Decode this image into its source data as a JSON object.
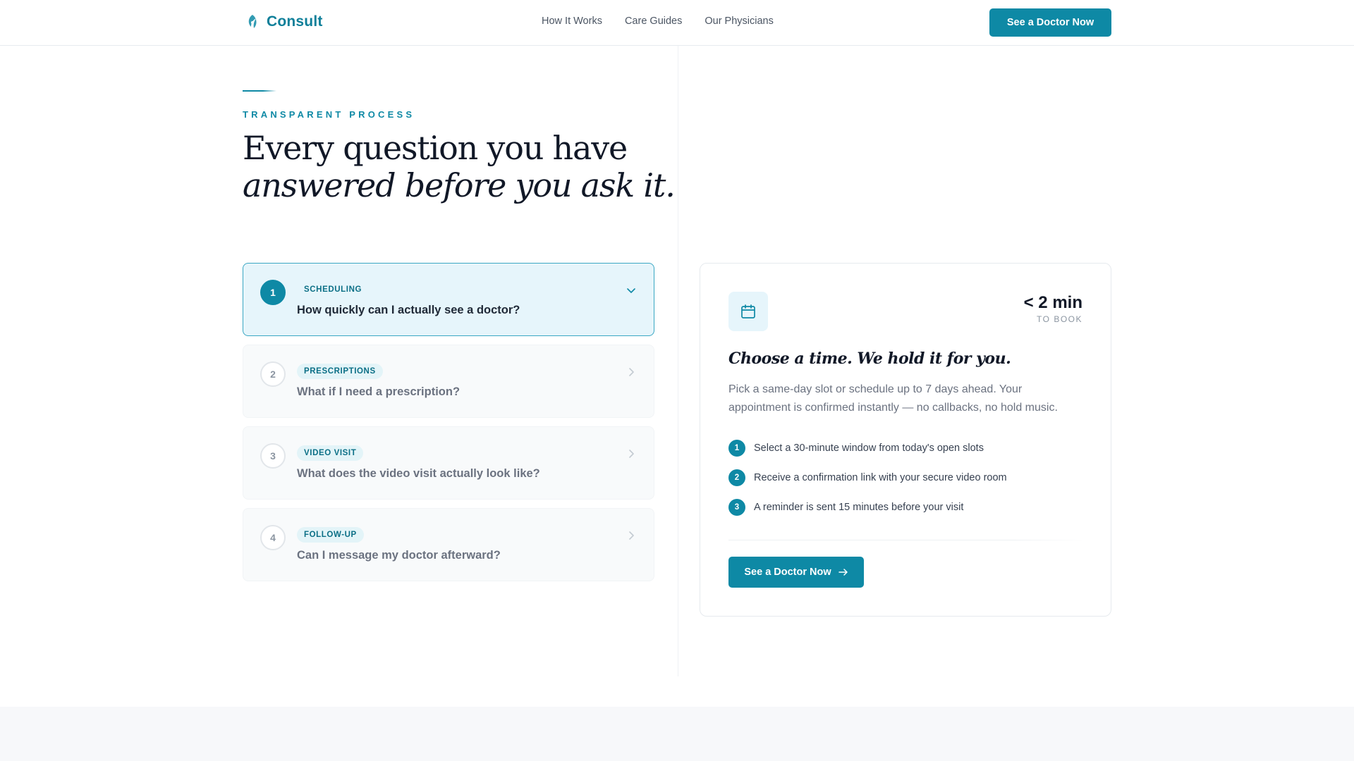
{
  "header": {
    "brand": "Consult",
    "nav": [
      "How It Works",
      "Care Guides",
      "Our Physicians"
    ],
    "cta_label": "See a Doctor Now"
  },
  "hero": {
    "eyebrow": "TRANSPARENT PROCESS",
    "headline_line1": "Every question you have",
    "headline_line2": "answered before you ask it."
  },
  "faq": [
    {
      "number": "1",
      "tag": "SCHEDULING",
      "question": "How quickly can I actually see a doctor?",
      "expanded": true
    },
    {
      "number": "2",
      "tag": "PRESCRIPTIONS",
      "question": "What if I need a prescription?",
      "expanded": false
    },
    {
      "number": "3",
      "tag": "VIDEO VISIT",
      "question": "What does the video visit actually look like?",
      "expanded": false
    },
    {
      "number": "4",
      "tag": "FOLLOW-UP",
      "question": "Can I message my doctor afterward?",
      "expanded": false
    }
  ],
  "detail": {
    "icon": "calendar-icon",
    "stat_value": "< 2 min",
    "stat_label": "TO BOOK",
    "title": "Choose a time. We hold it for you.",
    "description": "Pick a same-day slot or schedule up to 7 days ahead. Your appointment is confirmed instantly — no callbacks, no hold music.",
    "steps": [
      {
        "number": "1",
        "text": "Select a 30-minute window from today's open slots"
      },
      {
        "number": "2",
        "text": "Receive a confirmation link with your secure video room"
      },
      {
        "number": "3",
        "text": "A reminder is sent 15 minutes before your visit"
      }
    ],
    "cta_label": "See a Doctor Now"
  },
  "colors": {
    "accent": "#0e89a5",
    "accent_light": "#e6f5fb",
    "text_dark": "#111827",
    "text_muted": "#6b7280"
  }
}
